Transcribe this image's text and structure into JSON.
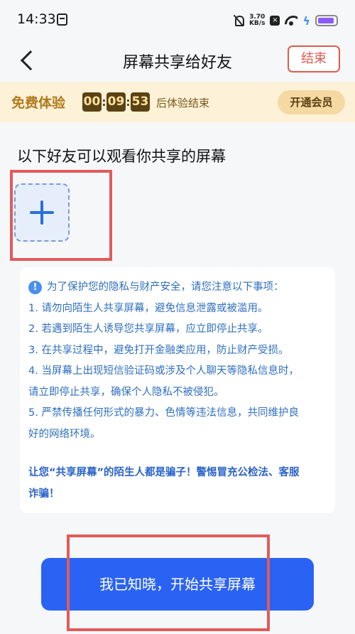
{
  "status_bar": {
    "time": "14:33",
    "net_speed_value": "3.70",
    "net_speed_unit": "KB/s",
    "battery_color": "#8a5cf6"
  },
  "nav": {
    "title": "屏幕共享给好友",
    "end_label": "结束"
  },
  "trial": {
    "label": "免费体验",
    "timer": [
      "00",
      "09",
      "53"
    ],
    "suffix": "后体验结束",
    "vip_label": "开通会员"
  },
  "friends": {
    "heading": "以下好友可以观看你共享的屏幕"
  },
  "notice": {
    "intro": "为了保护您的隐私与财产安全，请您注意以下事项：",
    "items": [
      "1. 请勿向陌生人共享屏幕，避免信息泄露或被滥用。",
      "2. 若遇到陌生人诱导您共享屏幕，应立即停止共享。",
      "3. 在共享过程中，避免打开金融类应用，防止财产受损。",
      "4. 当屏幕上出现短信验证码或涉及个人聊天等隐私信息时，",
      "请立即停止共享，确保个人隐私不被侵犯。",
      "5. 严禁传播任何形式的暴力、色情等违法信息，共同维护良",
      "好的网络环境。"
    ],
    "warning_line1": "让您“共享屏幕”的陌生人都是骗子！警惕冒充公检法、客服",
    "warning_line2": "诈骗！"
  },
  "start_button_label": "我已知晓，开始共享屏幕",
  "colors": {
    "accent": "#2a63f3",
    "highlight": "#e25a5a",
    "trial_bg": "#fdf1d8"
  }
}
